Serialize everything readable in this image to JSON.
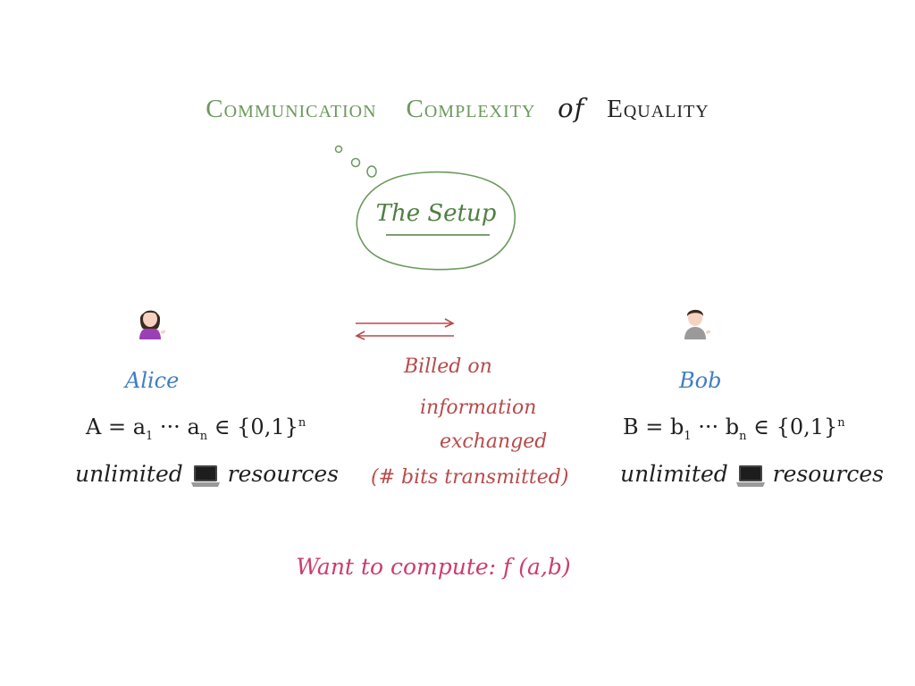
{
  "title": {
    "part1": "Communication",
    "part2": "Complexity",
    "part3": "of",
    "part4": "Equality"
  },
  "bubble": {
    "label": "The Setup"
  },
  "alice": {
    "name": "Alice",
    "formula_lhs": "A = a",
    "formula_sub1": "1",
    "formula_mid": " ··· a",
    "formula_subn": "n",
    "formula_rhs": " ∈ {0,1}",
    "formula_sup": "n",
    "resources_pre": "unlimited",
    "resources_post": "resources"
  },
  "bob": {
    "name": "Bob",
    "formula_lhs": "B = b",
    "formula_sub1": "1",
    "formula_mid": " ··· b",
    "formula_subn": "n",
    "formula_rhs": " ∈ {0,1}",
    "formula_sup": "n",
    "resources_pre": "unlimited",
    "resources_post": "resources"
  },
  "channel": {
    "line1": "Billed on",
    "line2": "information",
    "line3": "exchanged",
    "line4": "(# bits transmitted)"
  },
  "goal": {
    "text": "Want to compute: f (a,b)"
  },
  "colors": {
    "title_green": "#6a9a5c",
    "bubble_green": "#4e7f42",
    "name_blue": "#3f7ec2",
    "channel_red": "#b84a4a",
    "goal_pink": "#cc3d6c"
  },
  "icons": {
    "alice": "woman-tipping-hand-icon",
    "bob": "man-tipping-hand-icon",
    "laptop": "laptop-icon"
  }
}
